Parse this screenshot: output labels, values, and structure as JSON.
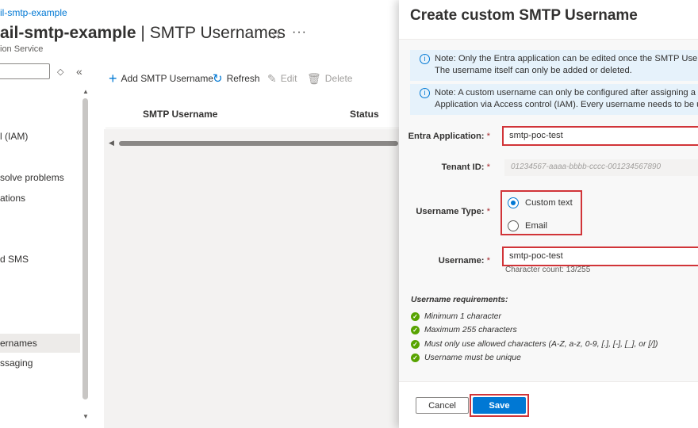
{
  "header": {
    "breadcrumb": "il-smtp-example",
    "title_bold": "ail-smtp-example",
    "title_sep": "|",
    "title_page": "SMTP Usernames",
    "subtitle": "ion Service"
  },
  "sidebar": {
    "items": [
      {
        "label": "l (IAM)"
      },
      {
        "label": "solve problems"
      },
      {
        "label": "ations"
      },
      {
        "label": "d SMS"
      },
      {
        "label": "ernames",
        "selected": true
      },
      {
        "label": "ssaging"
      }
    ]
  },
  "toolbar": {
    "add_label": "Add SMTP Username",
    "refresh_label": "Refresh",
    "edit_label": "Edit",
    "delete_label": "Delete"
  },
  "grid": {
    "columns": [
      "SMTP Username",
      "Status"
    ]
  },
  "panel": {
    "title": "Create custom SMTP Username",
    "notes": [
      {
        "line1": "Note: Only the Entra application can be edited once the SMTP Usernam",
        "line2": "The username itself can only be added or deleted."
      },
      {
        "line1": "Note: A custom username can only be configured after assigning a role",
        "line2": "Application via Access control (IAM). Every username needs to be uniqu"
      }
    ],
    "form": {
      "entra_label": "Entra Application:",
      "entra_value": "smtp-poc-test",
      "tenant_label": "Tenant ID:",
      "tenant_value": "01234567-aaaa-bbbb-cccc-001234567890",
      "type_label": "Username Type:",
      "type_options": [
        "Custom text",
        "Email"
      ],
      "type_selected": "Custom text",
      "username_label": "Username:",
      "username_value": "smtp-poc-test",
      "char_count": "Character count: 13/255",
      "required_marker": "*"
    },
    "requirements": {
      "title": "Username requirements:",
      "items": [
        "Minimum 1 character",
        "Maximum 255 characters",
        "Must only use allowed characters (A-Z, a-z, 0-9, [.], [-], [_], or [/])",
        "Username must be unique"
      ]
    },
    "buttons": {
      "cancel": "Cancel",
      "save": "Save"
    }
  },
  "colors": {
    "accent": "#0078d4",
    "highlight": "#d13438",
    "check": "#57a300"
  }
}
